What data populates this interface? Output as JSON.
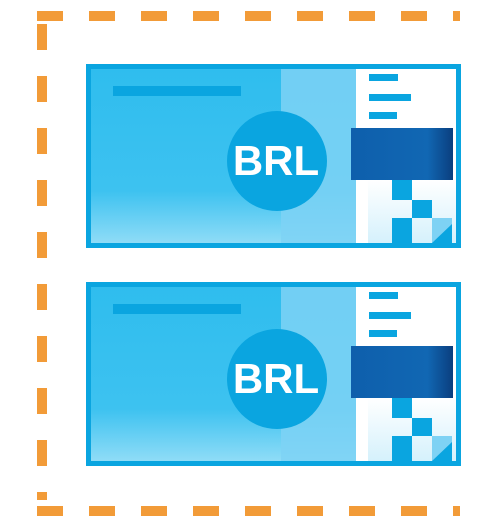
{
  "cards": [
    {
      "currency": "BRL"
    },
    {
      "currency": "BRL"
    }
  ],
  "colors": {
    "border_dash": "#F29B38",
    "card_outer": "#0AA5E0",
    "card_fill": "#36C0F0",
    "card_right_panel": "#7ED2F4",
    "stripe": "#0AA5E0",
    "coin": "#0AA5E0",
    "dark_band": "#0F62B0",
    "white": "#FFFFFF"
  },
  "icons": {
    "frame": "dashed-border-frame",
    "banknote": "banknote-icon"
  }
}
